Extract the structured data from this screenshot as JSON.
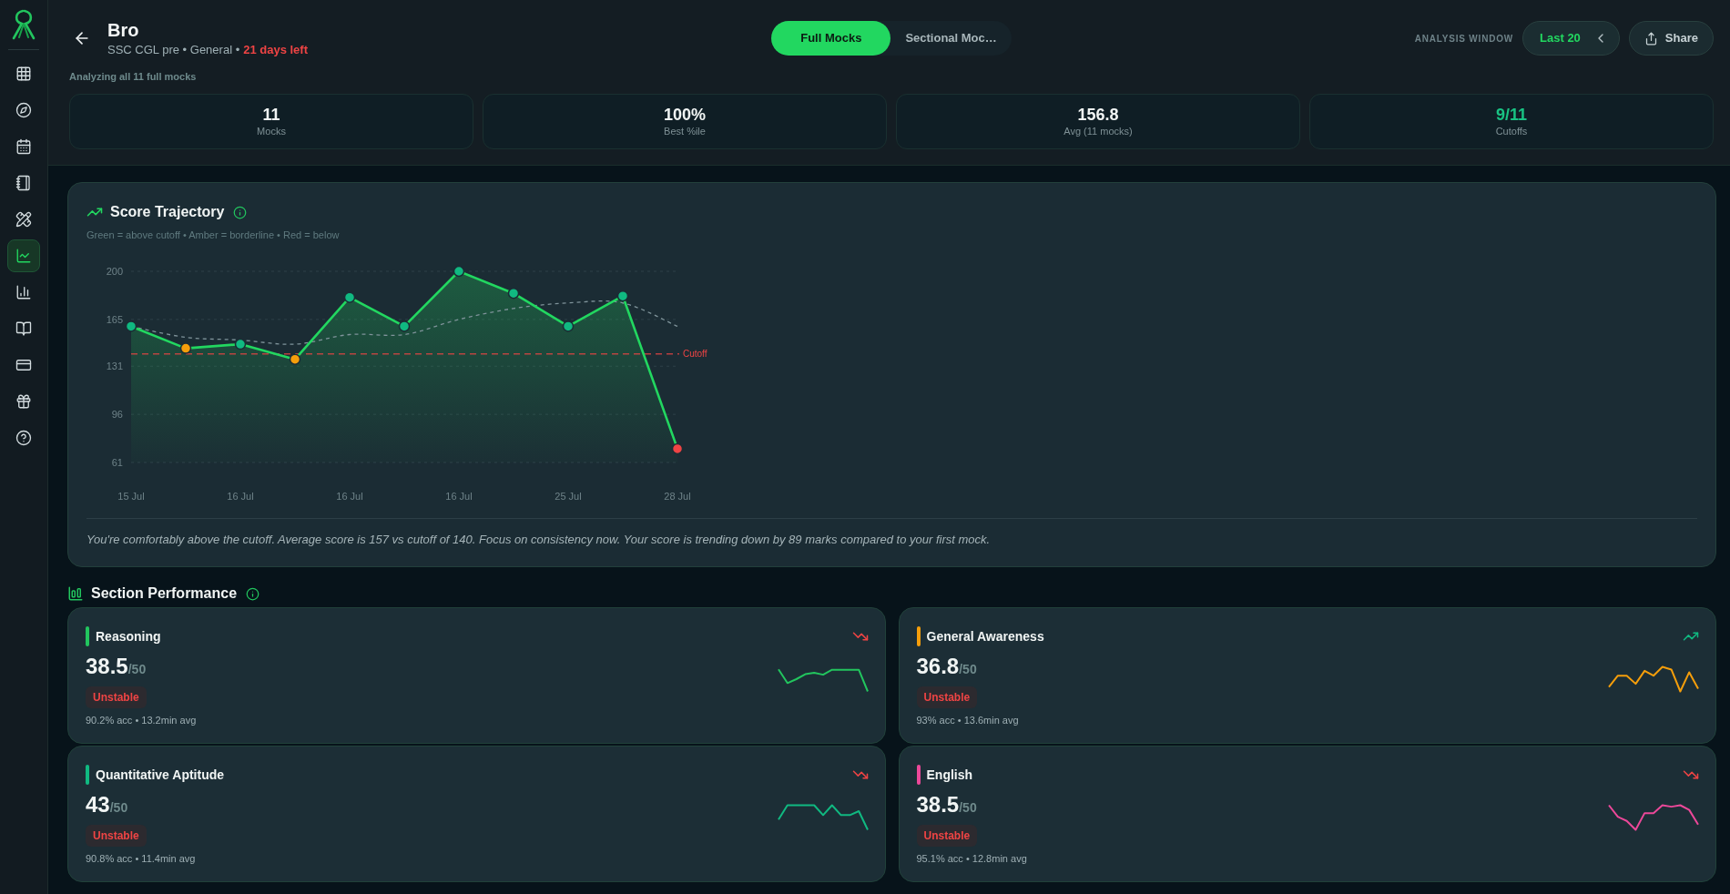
{
  "sidebar": {
    "items": [
      {
        "selected": false
      },
      {
        "selected": false
      },
      {
        "selected": false
      },
      {
        "selected": false
      },
      {
        "selected": false
      },
      {
        "selected": true
      },
      {
        "selected": false
      },
      {
        "selected": false
      },
      {
        "selected": false
      },
      {
        "selected": false
      },
      {
        "selected": false
      }
    ]
  },
  "header": {
    "title": "Bro",
    "subtitle": "SSC CGL pre • General •",
    "days_left": "21 days left",
    "tabs": [
      {
        "label": "Full Mocks",
        "selected": true
      },
      {
        "label": "Sectional Moc…",
        "selected": false
      }
    ],
    "analysis_window": {
      "label": "ANALYSIS WINDOW",
      "value": "Last 20"
    },
    "share_button": "Share",
    "note": "Analyzing all 11 full mocks",
    "stats": [
      {
        "value": "11",
        "label": "Mocks",
        "color": "#f1f5f4"
      },
      {
        "value": "100%",
        "label": "Best %ile",
        "color": "#f1f5f4"
      },
      {
        "value": "156.8",
        "label": "Avg (11 mocks)",
        "color": "#f1f5f4"
      },
      {
        "value": "9/11",
        "label": "Cutoffs",
        "color": "#19c283"
      }
    ]
  },
  "score_trajectory": {
    "title": "Score Trajectory",
    "legend": "Green = above cutoff • Amber = borderline • Red = below",
    "chart_data": {
      "type": "line",
      "categories": [
        "15 Jul",
        null,
        "16 Jul",
        null,
        "16 Jul",
        null,
        "16 Jul",
        null,
        "25 Jul",
        null,
        "28 Jul"
      ],
      "ylim": [
        61,
        200
      ],
      "yticks": [
        61,
        96,
        131,
        165,
        200
      ],
      "grid": true,
      "series": [
        {
          "type": "area",
          "color": "#22d760",
          "line_style": "solid",
          "marker": "circle",
          "values": [
            160,
            144,
            147,
            136,
            181,
            160,
            200,
            184,
            160,
            182,
            71
          ],
          "colors": [
            "#10b981",
            "#f59e0b",
            "#10b981",
            "#f59e0b",
            "#10b981",
            "#10b981",
            "#10b981",
            "#10b981",
            "#10b981",
            "#10b981",
            "#ef4444"
          ]
        },
        {
          "type": "line",
          "color": "#7f939a",
          "line_style": "dashed",
          "values": [
            160,
            152,
            150,
            147,
            154,
            154,
            165,
            173,
            177,
            177,
            160
          ]
        }
      ],
      "ref_lines": [
        {
          "axis": "y",
          "value": 140,
          "label": "Cutoff",
          "color": "#ef4444"
        }
      ]
    },
    "insight": "You're comfortably above the cutoff. Average score is 157 vs cutoff of 140. Focus on consistency now. Your score is trending down by 89 marks compared to your first mock."
  },
  "section_performance": {
    "title": "Section Performance",
    "sections": [
      {
        "name": "Reasoning",
        "color": "#22c55e",
        "score": "38.5",
        "max": "/50",
        "status": "Unstable",
        "stats": "90.2% acc • 13.2min avg",
        "rising": false
      },
      {
        "name": "General Awareness",
        "color": "#f59e0b",
        "score": "36.8",
        "max": "/50",
        "status": "Unstable",
        "stats": "93% acc • 13.6min avg",
        "rising": true
      },
      {
        "name": "Quantitative Aptitude",
        "color": "#10b981",
        "score": "43",
        "max": "/50",
        "status": "Unstable",
        "stats": "90.8% acc • 11.4min avg",
        "rising": false
      },
      {
        "name": "English",
        "color": "#ec4899",
        "score": "38.5",
        "max": "/50",
        "status": "Unstable",
        "stats": "95.1% acc • 12.8min avg",
        "rising": false
      }
    ]
  }
}
